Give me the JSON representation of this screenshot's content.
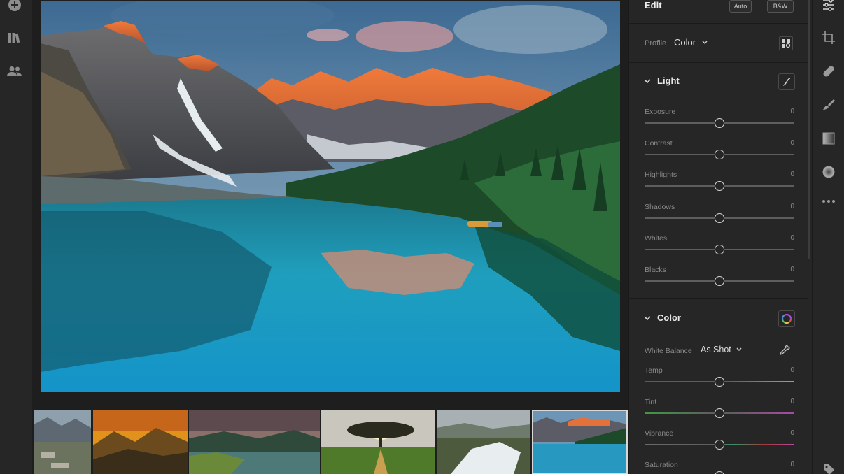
{
  "left_rail": {
    "icons": [
      "add-photo-icon",
      "library-icon",
      "people-icon"
    ]
  },
  "edit_panel": {
    "title": "Edit",
    "auto_label": "Auto",
    "bw_label": "B&W",
    "profile": {
      "label": "Profile",
      "value": "Color"
    },
    "light": {
      "title": "Light",
      "sliders": [
        {
          "label": "Exposure",
          "value": "0",
          "position": 0.5
        },
        {
          "label": "Contrast",
          "value": "0",
          "position": 0.5
        },
        {
          "label": "Highlights",
          "value": "0",
          "position": 0.5
        },
        {
          "label": "Shadows",
          "value": "0",
          "position": 0.5
        },
        {
          "label": "Whites",
          "value": "0",
          "position": 0.5
        },
        {
          "label": "Blacks",
          "value": "0",
          "position": 0.5
        }
      ]
    },
    "color": {
      "title": "Color",
      "white_balance": {
        "label": "White Balance",
        "value": "As Shot"
      },
      "sliders": [
        {
          "label": "Temp",
          "value": "0",
          "position": 0.5
        },
        {
          "label": "Tint",
          "value": "0",
          "position": 0.5
        },
        {
          "label": "Vibrance",
          "value": "0",
          "position": 0.5
        },
        {
          "label": "Saturation",
          "value": "0",
          "position": 0.5
        }
      ]
    }
  },
  "right_toolbar": {
    "icons": [
      "sliders-icon",
      "crop-icon",
      "healing-icon",
      "brush-icon",
      "linear-gradient-icon",
      "radial-gradient-icon",
      "more-icon",
      "tag-icon"
    ]
  },
  "filmstrip": {
    "thumbnails": [
      "coastal-rocks",
      "golden-mountains",
      "mountain-river",
      "sunset-tree",
      "waterfall",
      "mountain-lake"
    ],
    "selected_index": 5
  },
  "colors": {
    "panel_bg": "#262626",
    "app_bg": "#1e1e1e",
    "text": "#d8d8d8",
    "muted_text": "#8a8a8a"
  }
}
